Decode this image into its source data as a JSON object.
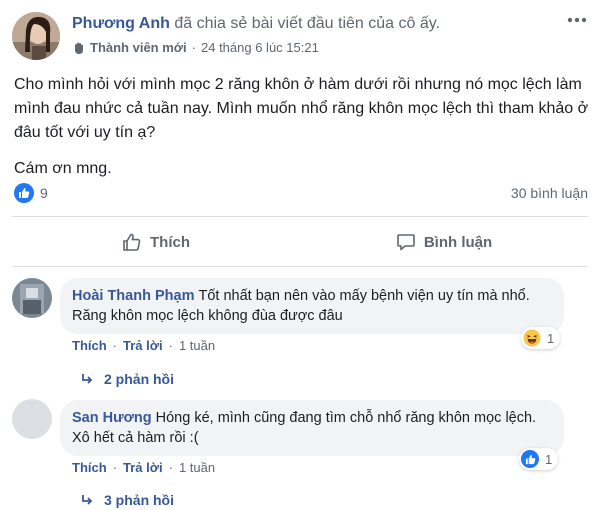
{
  "post": {
    "author": "Phương Anh",
    "action_text": "đã chia sẻ bài viết đầu tiên của cô ấy.",
    "badge": "Thành viên mới",
    "timestamp": "24 tháng 6 lúc 15:21",
    "paragraphs": [
      "Cho mình hỏi với mình mọc 2 răng khôn ở hàm dưới rồi nhưng nó mọc lệch làm mình đau nhức cả tuần nay. Mình muốn nhổ răng khôn mọc lệch thì tham khảo ở đâu tốt với uy tín ạ?",
      "Cám ơn mng."
    ],
    "like_count": "9",
    "comment_count": "30 bình luận"
  },
  "actions": {
    "like_label": "Thích",
    "comment_label": "Bình luận"
  },
  "comments": [
    {
      "name": "Hoài Thanh Phạm",
      "text": "Tốt nhất bạn nên vào mấy bệnh viện uy tín mà nhổ. Răng khôn mọc lệch không đùa được đâu",
      "like": "Thích",
      "reply": "Trả lời",
      "time": "1 tuần",
      "reaction_count": "1",
      "replies": "2 phản hồi"
    },
    {
      "name": "San Hương",
      "text": "Hóng ké, mình cũng đang tìm chỗ nhổ răng khôn mọc lệch. Xô hết cả hàm rồi :(",
      "like": "Thích",
      "reply": "Trả lời",
      "time": "1 tuần",
      "reaction_count": "1",
      "replies": "3 phản hồi"
    }
  ],
  "colors": {
    "link_blue": "#385898",
    "like_blue": "#2078f4",
    "muted": "#606770",
    "bubble_bg": "#f2f3f5"
  },
  "separator": "·"
}
